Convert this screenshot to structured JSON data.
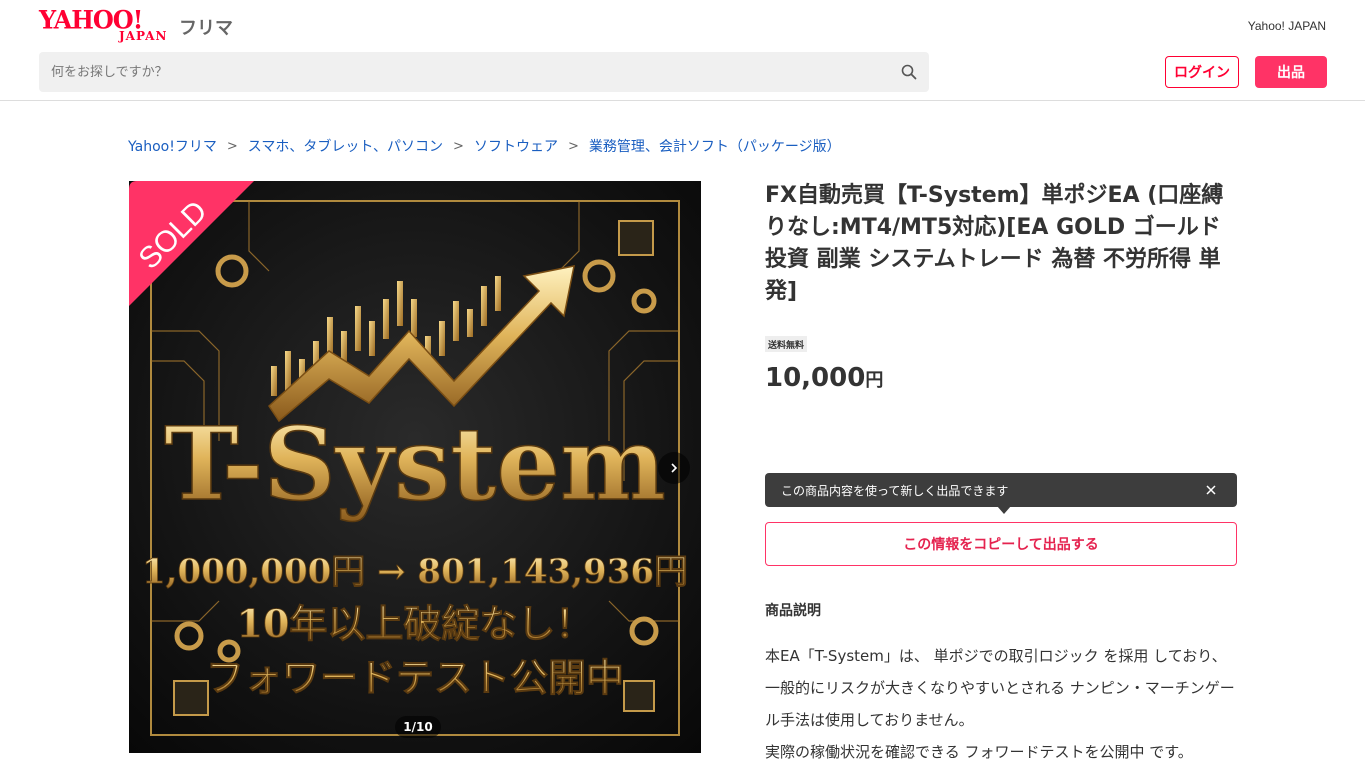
{
  "header": {
    "logo_yahoo": "YAHOO!",
    "logo_japan": "JAPAN",
    "logo_service": "フリマ",
    "yahoo_japan_link": "Yahoo! JAPAN",
    "search_placeholder": "何をお探しですか？",
    "login_label": "ログイン",
    "sell_label": "出品"
  },
  "breadcrumb": [
    "Yahoo!フリマ",
    "スマホ、タブレット、パソコン",
    "ソフトウェア",
    "業務管理、会計ソフト（パッケージ版）"
  ],
  "breadcrumb_separator": ">",
  "image": {
    "sold_label": "SOLD",
    "counter": "1/10",
    "headline": "T-System",
    "line1": "1,000,000円 → 801,143,936円",
    "line2": "10年以上破綻なし！",
    "line3": "フォワードテスト公開中"
  },
  "product": {
    "title": "FX自動売買【T-System】単ポジEA (口座縛りなし:MT4/MT5対応)[EA GOLD ゴールド 投資 副業 システムトレード 為替 不労所得 単発]",
    "shipping_badge": "送料無料",
    "price": "10,000",
    "price_unit": "円"
  },
  "tooltip": {
    "text": "この商品内容を使って新しく出品できます"
  },
  "copy_button": "この情報をコピーして出品する",
  "description": {
    "heading": "商品説明",
    "paragraph1": "本EA「T-System」は、 単ポジでの取引ロジック を採用 しており、 一般的にリスクが大きくなりやすいとされる ナンピン・マーチンゲール手法は使用しておりません。",
    "paragraph2": "実際の稼働状況を確認できる フォワードテストを公開中 です。"
  },
  "colors": {
    "brand_red": "#ff0033",
    "sell_button": "#ff3366",
    "link_blue": "#1a5ec0",
    "gold": "#d4a84a"
  }
}
